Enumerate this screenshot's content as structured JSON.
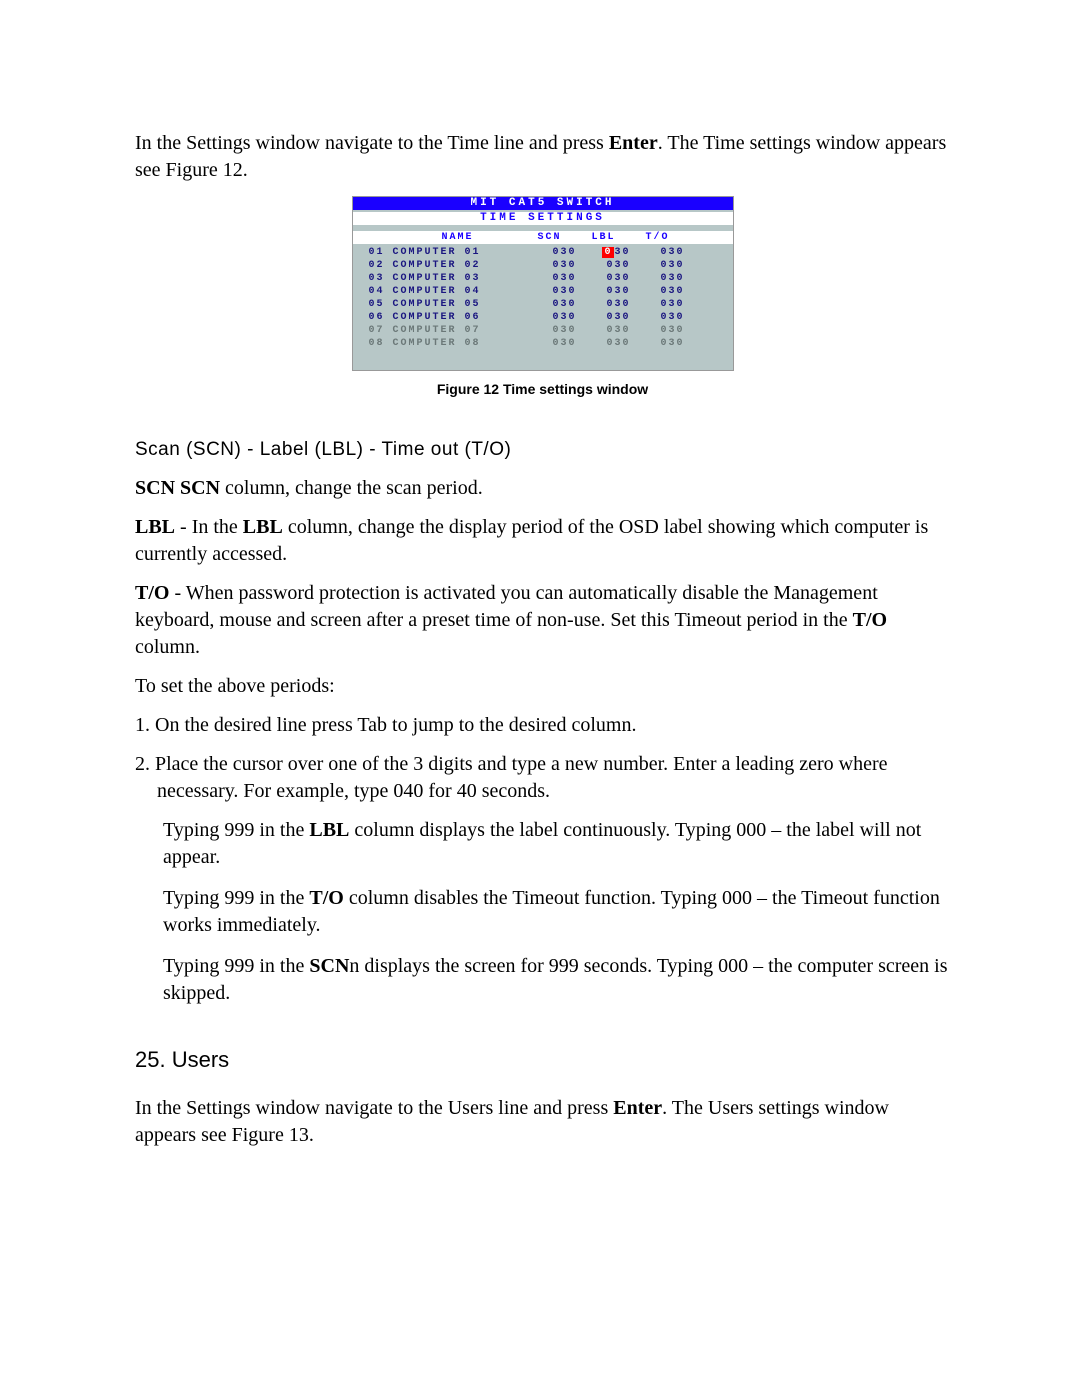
{
  "intro": {
    "pre1": "In the Settings window navigate to the Time line and press ",
    "enter": "Enter",
    "post1": ". The Time settings window appears see Figure 12."
  },
  "osd": {
    "title": "MIT  CAT5  SWITCH",
    "subtitle": "TIME  SETTINGS",
    "headers": {
      "name": "NAME",
      "scn": "SCN",
      "lbl": "LBL",
      "to": "T/O"
    },
    "rows": [
      {
        "num": "01",
        "name": "COMPUTER 01",
        "scn": "030",
        "lbl": "030",
        "to": "030",
        "active": true,
        "cursor_lbl": true
      },
      {
        "num": "02",
        "name": "COMPUTER 02",
        "scn": "030",
        "lbl": "030",
        "to": "030",
        "active": true
      },
      {
        "num": "03",
        "name": "COMPUTER 03",
        "scn": "030",
        "lbl": "030",
        "to": "030",
        "active": true
      },
      {
        "num": "04",
        "name": "COMPUTER 04",
        "scn": "030",
        "lbl": "030",
        "to": "030",
        "active": true
      },
      {
        "num": "05",
        "name": "COMPUTER 05",
        "scn": "030",
        "lbl": "030",
        "to": "030",
        "active": true
      },
      {
        "num": "06",
        "name": "COMPUTER 06",
        "scn": "030",
        "lbl": "030",
        "to": "030",
        "active": true
      },
      {
        "num": "07",
        "name": "COMPUTER 07",
        "scn": "030",
        "lbl": "030",
        "to": "030",
        "active": false
      },
      {
        "num": "08",
        "name": "COMPUTER 08",
        "scn": "030",
        "lbl": "030",
        "to": "030",
        "active": false
      }
    ]
  },
  "caption": "Figure 12 Time settings window",
  "scanLabel": "Scan (SCN) - Label (LBL) - Time out (T/O)",
  "scn_line": {
    "b": "SCN SCN",
    "rest": " column, change the scan period."
  },
  "lbl_line": {
    "b1": "LBL",
    "mid": " - In the ",
    "b2": "LBL",
    "rest": " column, change the display period of the OSD label showing which computer is currently accessed."
  },
  "to_line": {
    "b1": "T/O",
    "mid": " - When password protection is activated you can automatically disable the Management keyboard, mouse and screen after a preset time of non-use. Set this Timeout period in the ",
    "b2": "T/O",
    "rest": " column."
  },
  "toSet": "To set the above periods:",
  "li1": "On the desired line press Tab to jump to the desired column.",
  "li2": "Place the cursor over one of the 3 digits and type a new number. Enter a leading zero where necessary. For example, type 040 for 40 seconds.",
  "sub1": {
    "pre": "Typing 999 in the ",
    "b": "LBL",
    "post": " column displays the label continuously. Typing 000 – the label will not appear."
  },
  "sub2": {
    "pre": "Typing 999 in the ",
    "b": "T/O",
    "post": " column disables the Timeout function. Typing 000 – the Timeout function works immediately."
  },
  "sub3": {
    "pre": "Typing 999 in the ",
    "b": "SCN",
    "post": "n displays the screen for 999 seconds. Typing 000 – the computer screen is skipped."
  },
  "section": "25. Users",
  "outro": {
    "pre": "In the Settings window navigate to the Users line and press ",
    "b": "Enter",
    "post": ". The Users settings window appears see Figure 13."
  }
}
